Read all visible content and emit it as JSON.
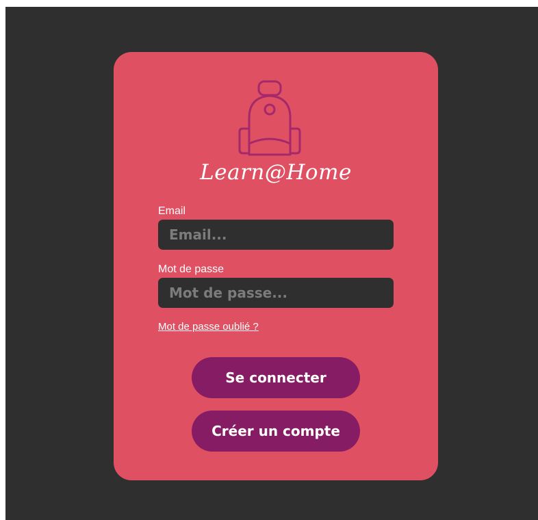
{
  "colors": {
    "background": "#2f2f2f",
    "card": "#e05063",
    "button": "#861c63",
    "logo_stroke": "#a4286a",
    "text": "#ffffff",
    "placeholder": "#7c7c7c"
  },
  "logo": {
    "icon": "backpack-icon"
  },
  "brand": {
    "name": "Learn@Home"
  },
  "form": {
    "email": {
      "label": "Email",
      "placeholder": "Email...",
      "value": ""
    },
    "password": {
      "label": "Mot de passe",
      "placeholder": "Mot de passe...",
      "value": ""
    },
    "forgot_link": "Mot de passe oublié ?"
  },
  "buttons": {
    "login": "Se connecter",
    "create_account": "Créer un compte"
  }
}
